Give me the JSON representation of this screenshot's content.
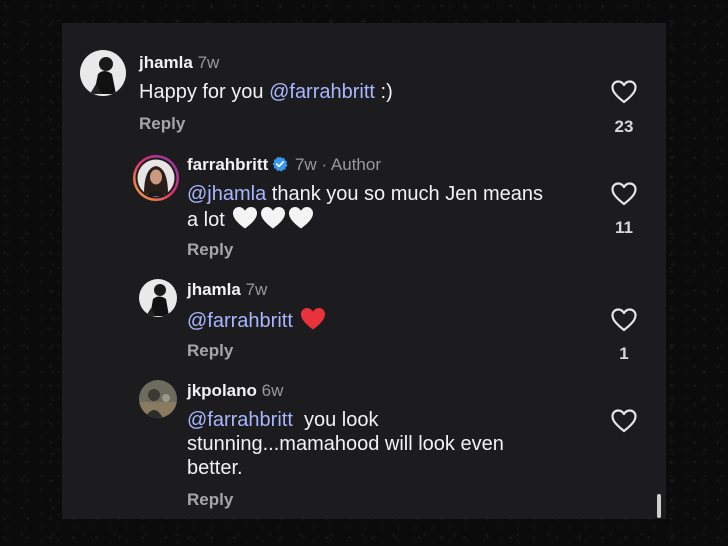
{
  "comments": [
    {
      "username": "jhamla",
      "time": "7w",
      "text": "Happy for you",
      "mention": "@farrahbritt",
      "after": " :)",
      "reply": "Reply",
      "likes": "23"
    },
    {
      "username": "farrahbritt",
      "time": "7w",
      "sep": "·",
      "role": "Author",
      "mention": "@jhamla",
      "text": " thank you so much Jen means",
      "text2": "a lot",
      "reply": "Reply",
      "likes": "11",
      "emoji": [
        "white-heart",
        "white-heart",
        "white-heart"
      ]
    },
    {
      "username": "jhamla",
      "time": "7w",
      "mention": "@farrahbritt",
      "reply": "Reply",
      "likes": "1",
      "emoji": [
        "red-heart"
      ]
    },
    {
      "username": "jkpolano",
      "time": "6w",
      "mention": "@farrahbritt",
      "text": "  you look",
      "text2": "stunning...mamahood will look even",
      "text3": "better.",
      "reply": "Reply"
    }
  ],
  "colors": {
    "background": "#1c1c1e",
    "mention": "#a9b6ff",
    "verified": "#3897f0",
    "red_heart": "#e8333b"
  }
}
